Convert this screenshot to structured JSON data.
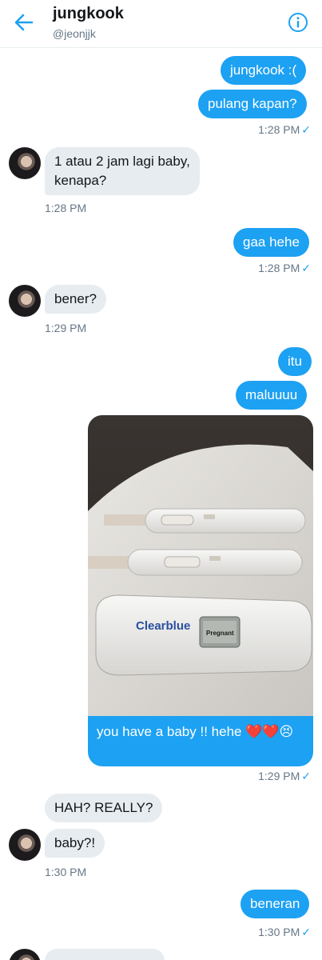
{
  "header": {
    "title": "jungkook",
    "handle": "@jeonjjk"
  },
  "messages": {
    "m1": "jungkook :(",
    "m2": "pulang kapan?",
    "ts1": "1:28 PM",
    "m3_line1": "1 atau 2 jam lagi baby,",
    "m3_line2": "kenapa?",
    "ts2": "1:28 PM",
    "m4": "gaa hehe",
    "ts3": "1:28 PM",
    "m5": "bener?",
    "ts4": "1:29 PM",
    "m6": "itu",
    "m7": "maluuuu",
    "photo_brand": "Clearblue",
    "photo_screen": "Pregnant",
    "m8": "you have a baby !! hehe ❤️❤️😣",
    "ts5": "1:29 PM",
    "m9": "HAH? REALLY?",
    "m10": "baby?!",
    "ts6": "1:30 PM",
    "m11": "beneran",
    "ts7": "1:30 PM"
  },
  "icons": {
    "back": "back-arrow-icon",
    "info": "info-icon",
    "read": "checkmark-icon"
  },
  "colors": {
    "outgoing": "#1da1f2",
    "incoming": "#e6ecf0",
    "meta": "#657786"
  }
}
